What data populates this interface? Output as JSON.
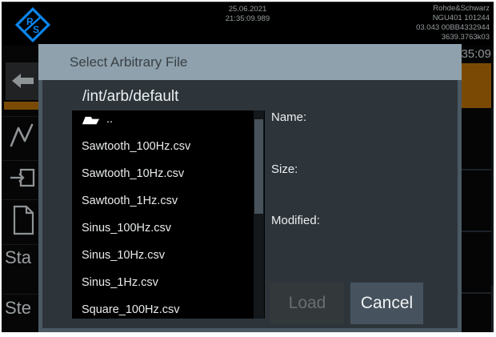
{
  "topbar": {
    "date": "25.06.2021",
    "time": "21:35:09.989",
    "device": {
      "brand": "Rohde&Schwarz",
      "model": "NGU401 101244",
      "firmware": "03.043 00BB4332944",
      "material": "3639.3763k03"
    }
  },
  "background": {
    "clock_fragment": "35:09",
    "sidebar_labels": {
      "start": "Sta",
      "step": "Ste"
    }
  },
  "dialog": {
    "title": "Select Arbitrary File",
    "path": "/int/arb/default",
    "files": [
      "..",
      "Sawtooth_100Hz.csv",
      "Sawtooth_10Hz.csv",
      "Sawtooth_1Hz.csv",
      "Sinus_100Hz.csv",
      "Sinus_10Hz.csv",
      "Sinus_1Hz.csv",
      "Square_100Hz.csv"
    ],
    "info": {
      "name_label": "Name:",
      "size_label": "Size:",
      "modified_label": "Modified:"
    },
    "buttons": {
      "load": "Load",
      "cancel": "Cancel"
    }
  },
  "colors": {
    "accent_orange": "#7a4a04",
    "title_bar": "#8ea1ad",
    "dialog_body": "#2d353b",
    "dialog_border": "#4b5963",
    "logo_blue": "#0a86f0",
    "list_bg": "#000000"
  }
}
